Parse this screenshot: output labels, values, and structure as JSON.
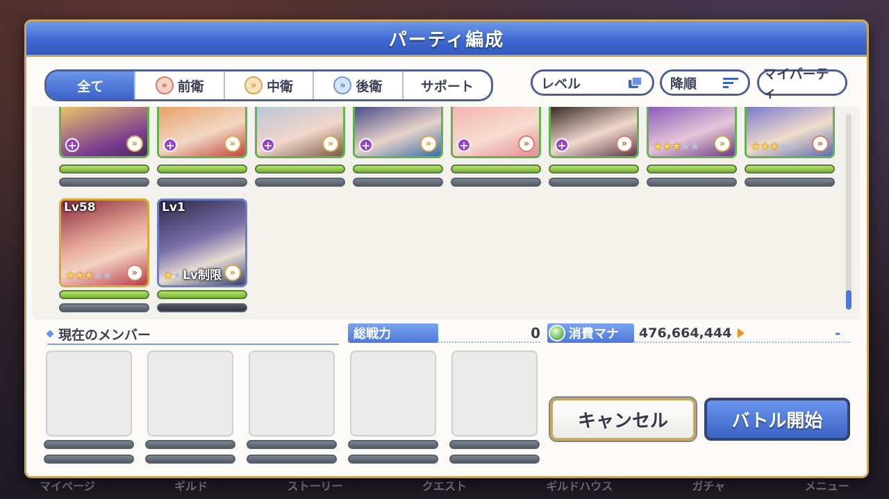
{
  "window": {
    "title": "パーティ編成"
  },
  "filter_tabs": [
    {
      "label": "全て",
      "icon": ""
    },
    {
      "label": "前衛",
      "icon": "front-role-icon"
    },
    {
      "label": "中衛",
      "icon": "mid-role-icon"
    },
    {
      "label": "後衛",
      "icon": "back-role-icon"
    },
    {
      "label": "サポート",
      "icon": ""
    }
  ],
  "sort": {
    "key_label": "レベル",
    "order_label": "降順",
    "my_party_label": "マイパーティ"
  },
  "roster_row1": [
    {
      "badge": "plus",
      "role": "mid"
    },
    {
      "badge": "plus",
      "role": "mid"
    },
    {
      "badge": "plus",
      "role": "mid"
    },
    {
      "badge": "plus",
      "role": "mid"
    },
    {
      "badge": "plus",
      "role": "front"
    },
    {
      "badge": "plus",
      "role": "front"
    },
    {
      "stars": 3,
      "max_stars": 5,
      "role": "mid"
    },
    {
      "stars": 3,
      "max_stars": 5,
      "role": "front"
    }
  ],
  "roster_row2": [
    {
      "level": "Lv58",
      "stars": 3,
      "max_stars": 5,
      "role": "front"
    },
    {
      "level": "Lv1",
      "caption": "Lv制限",
      "stars": 1,
      "max_stars": 5,
      "role": "mid"
    }
  ],
  "members": {
    "header": "現在のメンバー",
    "slots": 5
  },
  "stats": {
    "power_label": "総戦力",
    "power_value": "0",
    "mana_label": "消費マナ",
    "mana_value": "476,664,444",
    "mana_delta": "-"
  },
  "buttons": {
    "cancel": "キャンセル",
    "battle": "バトル開始"
  },
  "bottom_nav": [
    "マイページ",
    "ギルド",
    "ストーリー",
    "クエスト",
    "ギルドハウス",
    "ガチャ",
    "メニュー"
  ],
  "colors": {
    "accent": "#3e6ad1",
    "frame_gold": "#c9a45a",
    "green_bar": "#74b236"
  }
}
